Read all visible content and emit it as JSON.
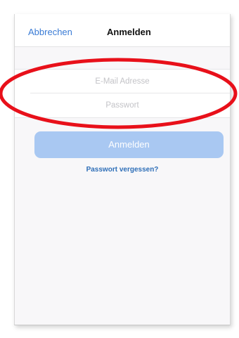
{
  "navbar": {
    "cancel_label": "Abbrechen",
    "title": "Anmelden"
  },
  "form": {
    "email_placeholder": "E-Mail Adresse",
    "email_value": "",
    "password_placeholder": "Passwort",
    "password_value": ""
  },
  "actions": {
    "login_label": "Anmelden",
    "forgot_password_label": "Passwort vergessen?"
  },
  "colors": {
    "link": "#3a7bd5",
    "button_disabled": "#a9c8f2",
    "annotation": "#e8101a"
  },
  "annotation": {
    "shape": "ellipse",
    "target": "form-fields"
  }
}
